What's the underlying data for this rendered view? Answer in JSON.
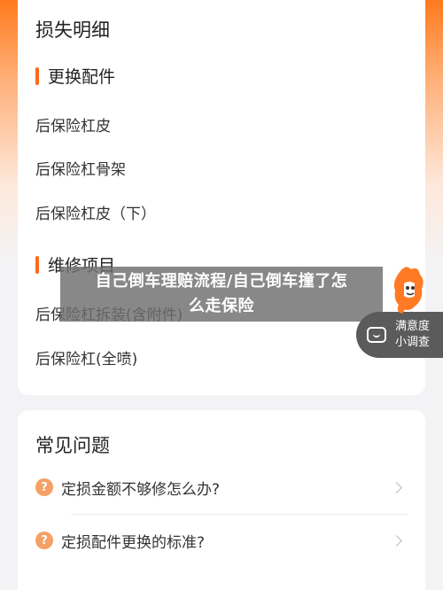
{
  "loss_card": {
    "title": "损失明细",
    "sections": [
      {
        "heading": "更换配件",
        "items": [
          "后保险杠皮",
          "后保险杠骨架",
          "后保险杠皮（下）"
        ]
      },
      {
        "heading": "维修项目",
        "items": [
          "后保险杠拆装(含附件)",
          "后保险杠(全喷)"
        ]
      }
    ]
  },
  "faq_card": {
    "title": "常见问题",
    "question_badge": "?",
    "questions": [
      "定损金额不够修怎么办?",
      "定损配件更换的标准?"
    ]
  },
  "banner": {
    "line1": "自己倒车理赔流程/自己倒车撞了怎",
    "line2": "么走保险"
  },
  "satisfaction": {
    "line1": "满意度",
    "line2": "小调查",
    "icon": "chat-smile-icon"
  },
  "colors": {
    "accent": "#ff6a1a",
    "question_badge": "#f5a066",
    "header_gradient_top": "#ff7a1c"
  }
}
